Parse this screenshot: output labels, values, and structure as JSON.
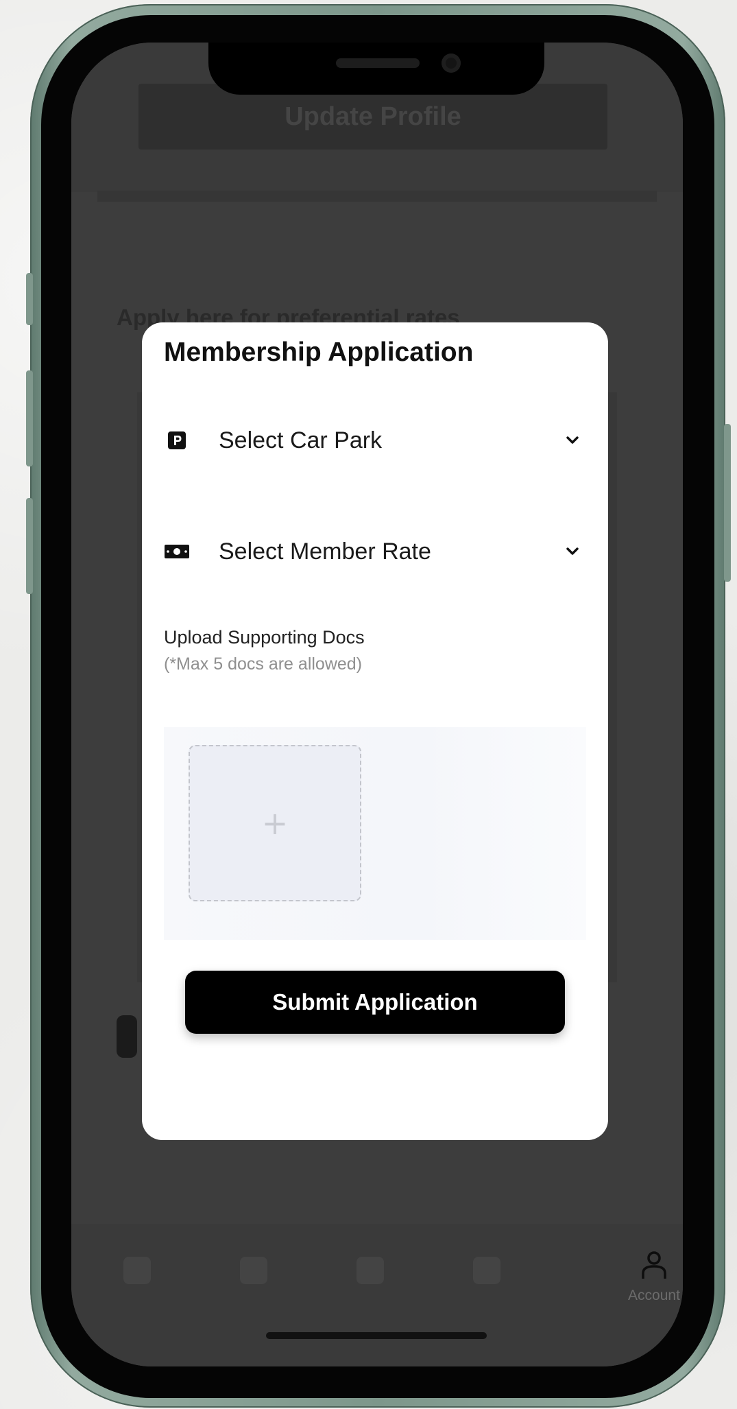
{
  "background_app": {
    "header_button_label": "Update Profile",
    "section_heading": "Apply here for preferential rates",
    "tabbar": {
      "account_label": "Account"
    }
  },
  "modal": {
    "title": "Membership Application",
    "car_park_select": {
      "label": "Select Car Park",
      "icon": "parking-icon"
    },
    "member_rate_select": {
      "label": "Select Member Rate",
      "icon": "banknote-icon"
    },
    "upload": {
      "title": "Upload Supporting Docs",
      "note": "(*Max 5 docs are allowed)",
      "add_symbol": "+"
    },
    "submit_label": "Submit Application"
  },
  "colors": {
    "phone_frame": "#7d978b",
    "overlay": "#3d3d3d",
    "modal_bg": "#ffffff",
    "primary_button": "#000000",
    "upload_tile_bg": "#eceef5"
  }
}
